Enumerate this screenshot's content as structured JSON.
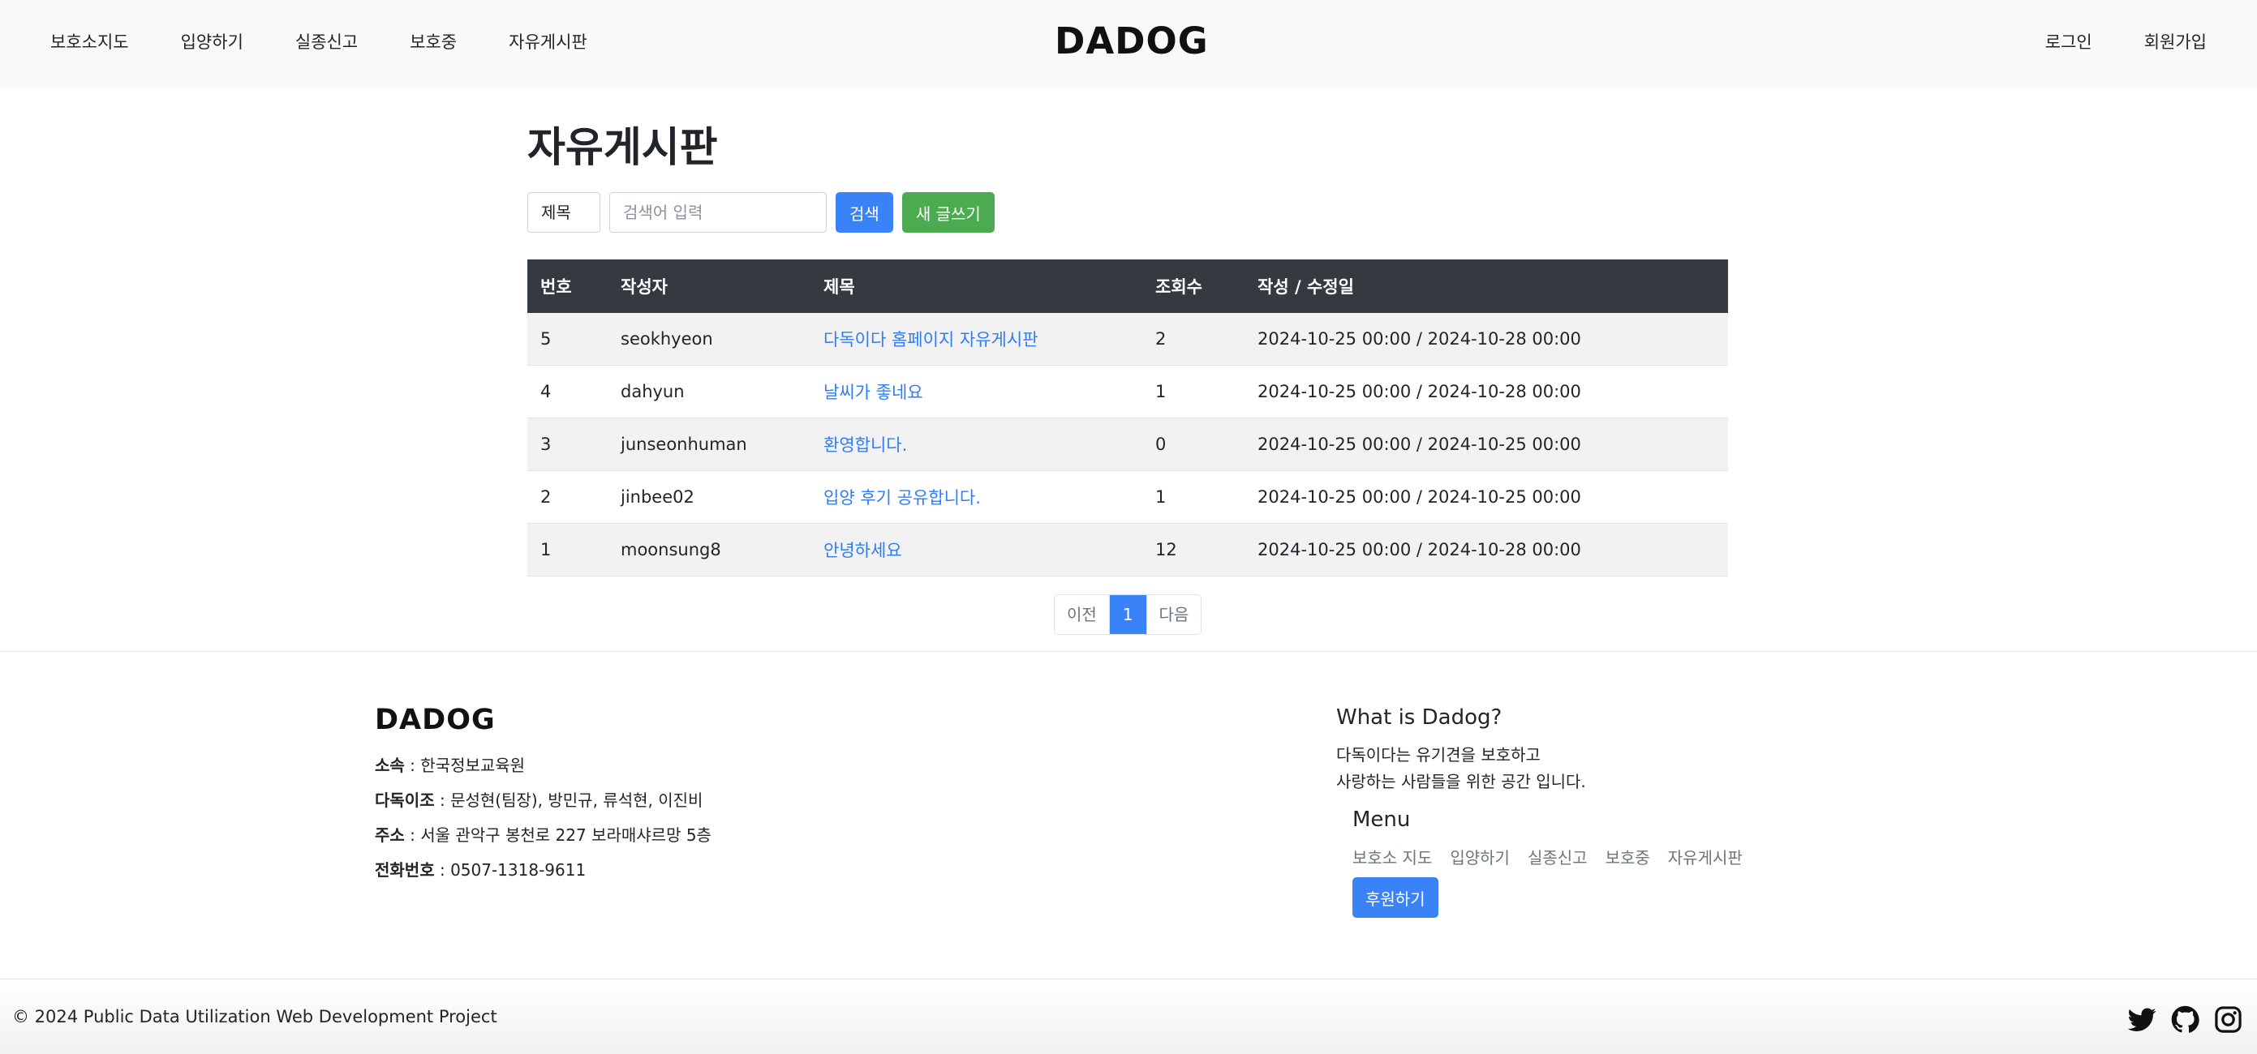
{
  "nav": {
    "left_items": [
      "보호소지도",
      "입양하기",
      "실종신고",
      "보호중",
      "자유게시판"
    ],
    "brand": "DADOG",
    "right_items": [
      "로그인",
      "회원가입"
    ]
  },
  "board": {
    "title": "자유게시판",
    "search_select": "제목",
    "search_placeholder": "검색어 입력",
    "search_button": "검색",
    "new_post_button": "새 글쓰기",
    "columns": [
      "번호",
      "작성자",
      "제목",
      "조회수",
      "작성 / 수정일"
    ],
    "rows": [
      {
        "no": "5",
        "author": "seokhyeon",
        "title": "다독이다 홈페이지 자유게시판",
        "views": "2",
        "dates": "2024-10-25 00:00 / 2024-10-28 00:00"
      },
      {
        "no": "4",
        "author": "dahyun",
        "title": "날씨가 좋네요",
        "views": "1",
        "dates": "2024-10-25 00:00 / 2024-10-28 00:00"
      },
      {
        "no": "3",
        "author": "junseonhuman",
        "title": "환영합니다.",
        "views": "0",
        "dates": "2024-10-25 00:00 / 2024-10-25 00:00"
      },
      {
        "no": "2",
        "author": "jinbee02",
        "title": "입양 후기 공유합니다.",
        "views": "1",
        "dates": "2024-10-25 00:00 / 2024-10-25 00:00"
      },
      {
        "no": "1",
        "author": "moonsung8",
        "title": "안녕하세요",
        "views": "12",
        "dates": "2024-10-25 00:00 / 2024-10-28 00:00"
      }
    ],
    "pagination": {
      "prev": "이전",
      "current": "1",
      "next": "다음"
    }
  },
  "footer": {
    "logo": "DADOG",
    "info": [
      {
        "label": "소속",
        "value": " : 한국정보교육원"
      },
      {
        "label": "다독이조",
        "value": " : 문성현(팀장), 방민규, 류석현, 이진비"
      },
      {
        "label": "주소",
        "value": " : 서울 관악구 봉천로 227 보라매샤르망 5층"
      },
      {
        "label": "전화번호",
        "value": " : 0507-1318-9611"
      }
    ],
    "about_title": "What is Dadog?",
    "about_lines": [
      "다독이다는 유기견을 보호하고",
      "사랑하는 사람들을 위한 공간 입니다."
    ],
    "menu_title": "Menu",
    "menu_items": [
      "보호소 지도",
      "입양하기",
      "실종신고",
      "보호중",
      "자유게시판"
    ],
    "sponsor_button": "후원하기",
    "copyright": "© 2024 Public Data Utilization Web Development Project",
    "social_icons": [
      "twitter-icon",
      "github-icon",
      "instagram-icon"
    ]
  },
  "colors": {
    "primary": "#3a82f7",
    "success": "#4caa50",
    "table_header": "#343a40",
    "link": "#2f7df6",
    "navbar_bg": "#f8f9fa"
  }
}
